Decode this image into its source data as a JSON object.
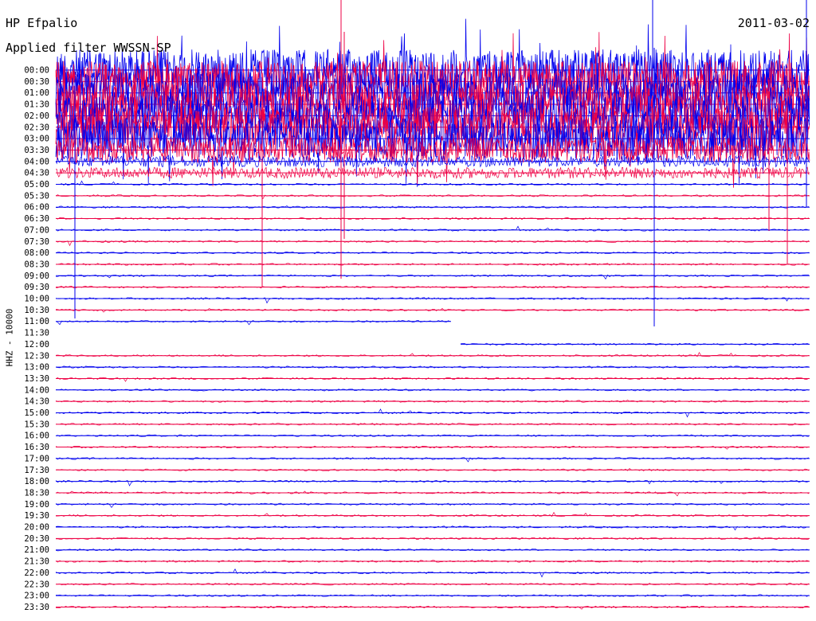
{
  "header": {
    "station": "HP Efpalio",
    "filter": "Applied filter WWSSN-SP",
    "date": "2011-03-02",
    "channel": "HHZ - 10000"
  },
  "colors": {
    "blue": "#0000ee",
    "red": "#ee0044",
    "text": "#000000"
  },
  "chart_data": {
    "type": "line",
    "title": "HP Efpalio",
    "subtitle": "Applied filter WWSSN-SP",
    "ylabel": "HHZ - 10000",
    "xlabel": "",
    "grid": false,
    "legend": "none",
    "trace_minutes": 30,
    "row_colors": [
      "blue",
      "red"
    ],
    "tick_labels": [
      "00:00",
      "00:30",
      "01:00",
      "01:30",
      "02:00",
      "02:30",
      "03:00",
      "03:30",
      "04:00",
      "04:30",
      "05:00",
      "05:30",
      "06:00",
      "06:30",
      "07:00",
      "07:30",
      "08:00",
      "08:30",
      "09:00",
      "09:30",
      "10:00",
      "10:30",
      "11:00",
      "11:30",
      "12:00",
      "12:30",
      "13:00",
      "13:30",
      "14:00",
      "14:30",
      "15:00",
      "15:30",
      "16:00",
      "16:30",
      "17:00",
      "17:30",
      "18:00",
      "18:30",
      "19:00",
      "19:30",
      "20:00",
      "20:30",
      "21:00",
      "21:30",
      "22:00",
      "22:30",
      "23:00",
      "23:30"
    ],
    "row_activity": [
      "very-high",
      "very-high",
      "very-high",
      "very-high",
      "very-high",
      "very-high",
      "very-high",
      "high",
      "moderate",
      "moderate",
      "low",
      "low",
      "low",
      "low",
      "low",
      "low",
      "low",
      "low",
      "low",
      "low",
      "low",
      "low",
      "low",
      "gap",
      "partial",
      "low",
      "low",
      "low",
      "low",
      "low",
      "low",
      "low",
      "low",
      "low",
      "low",
      "low",
      "low",
      "low",
      "low",
      "low",
      "low",
      "low",
      "low",
      "low",
      "low",
      "low",
      "low",
      "low"
    ],
    "events": [
      {
        "time": "05:00",
        "description": "burst"
      },
      {
        "time": "09:00",
        "description": "burst"
      },
      {
        "time": "11:00",
        "description": "burst"
      },
      {
        "time": "15:30",
        "description": "burst"
      },
      {
        "time": "16:30",
        "description": "burst"
      },
      {
        "time": "17:30",
        "description": "bursts"
      }
    ]
  }
}
